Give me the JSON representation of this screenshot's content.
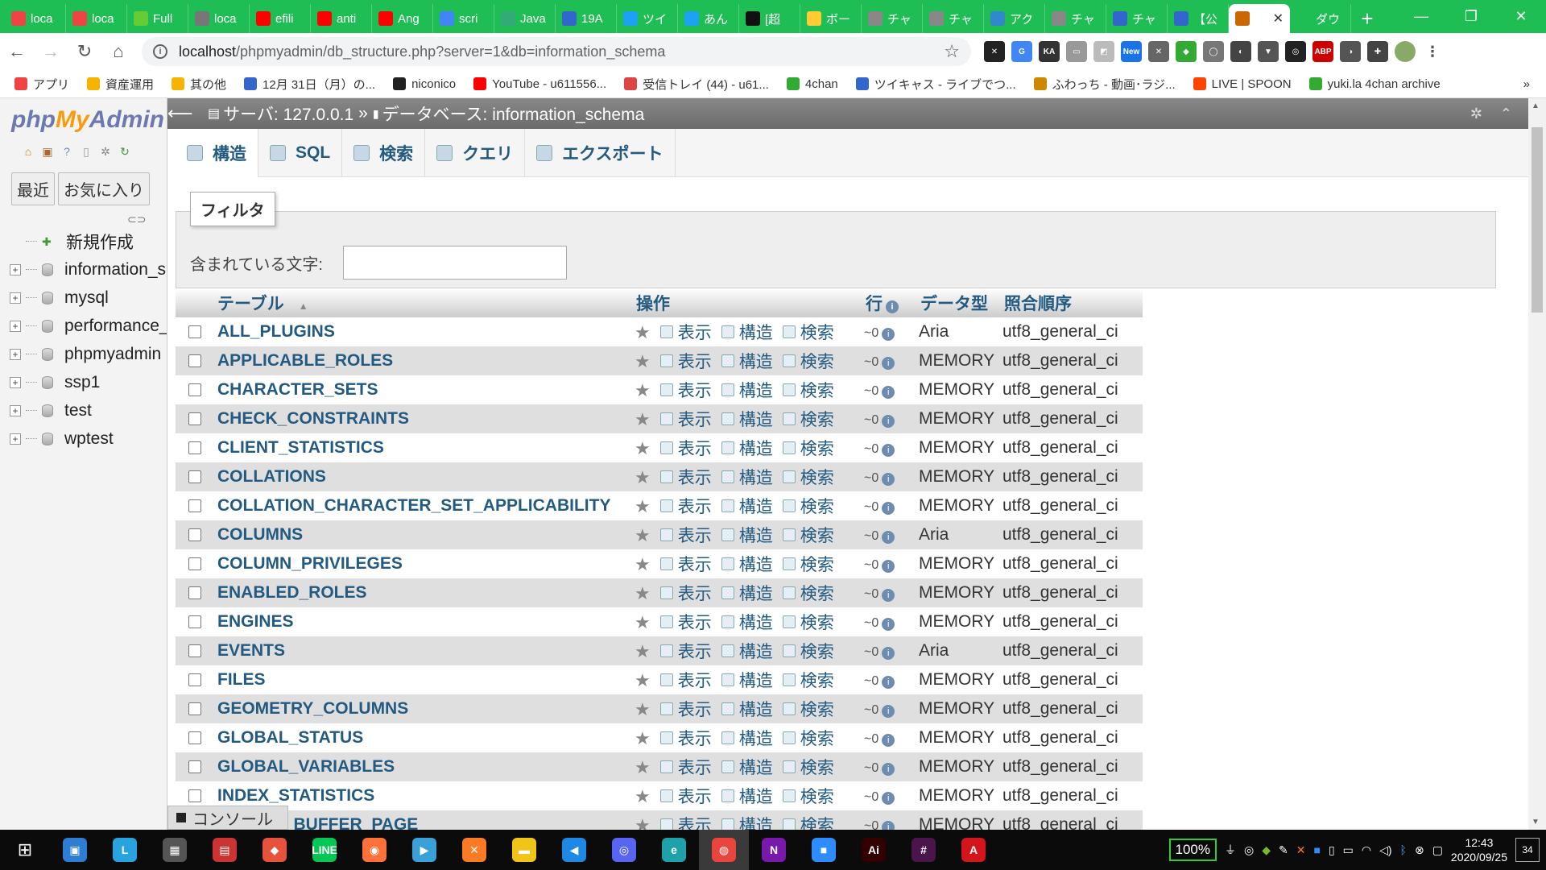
{
  "browser": {
    "tabs": [
      {
        "label": "loca",
        "color": "#e44"
      },
      {
        "label": "loca",
        "color": "#e44"
      },
      {
        "label": "Full",
        "color": "#6c3"
      },
      {
        "label": "loca",
        "color": "#777"
      },
      {
        "label": "efili",
        "color": "#f00"
      },
      {
        "label": "anti",
        "color": "#f00"
      },
      {
        "label": "Ang",
        "color": "#f00"
      },
      {
        "label": "scri",
        "color": "#4285f4"
      },
      {
        "label": "Java",
        "color": "#3a7"
      },
      {
        "label": "19A",
        "color": "#36c"
      },
      {
        "label": "ツイ",
        "color": "#1da1f2"
      },
      {
        "label": "あん",
        "color": "#1da1f2"
      },
      {
        "label": "[超",
        "color": "#111"
      },
      {
        "label": "ボー",
        "color": "#fc3"
      },
      {
        "label": "チャ",
        "color": "#888"
      },
      {
        "label": "チャ",
        "color": "#888"
      },
      {
        "label": "アク",
        "color": "#38c"
      },
      {
        "label": "チャ",
        "color": "#888"
      },
      {
        "label": "チャ",
        "color": "#36c"
      },
      {
        "label": "【公",
        "color": "#36c"
      },
      {
        "label": "",
        "color": "#c60",
        "active": true
      },
      {
        "label": "ダウ",
        "color": "#1fbe55"
      }
    ],
    "url_host": "localhost",
    "url_path": "/phpmyadmin/db_structure.php?server=1&db=information_schema",
    "bookmarks": [
      "アプリ",
      "資産運用",
      "其の他",
      "12月 31日（月）の...",
      "niconico",
      "YouTube - u611556...",
      "受信トレイ (44) - u61...",
      "4chan",
      "ツイキャス - ライブでつ...",
      "ふわっち - 動画･ラジ...",
      "LIVE | SPOON",
      "yuki.la 4chan archive"
    ],
    "bookmarks_more": "»",
    "new_ext_label": "New"
  },
  "nav": {
    "logo_php": "php",
    "logo_my": "My",
    "logo_admin": "Admin",
    "tab_recent": "最近",
    "tab_favorites": "お気に入り",
    "tree": [
      {
        "label": "新規作成",
        "type": "new"
      },
      {
        "label": "information_s",
        "type": "db"
      },
      {
        "label": "mysql",
        "type": "db"
      },
      {
        "label": "performance_",
        "type": "db"
      },
      {
        "label": "phpmyadmin",
        "type": "db"
      },
      {
        "label": "ssp1",
        "type": "db"
      },
      {
        "label": "test",
        "type": "db"
      },
      {
        "label": "wptest",
        "type": "db"
      }
    ]
  },
  "breadcrumb": {
    "server_label": "サーバ: 127.0.0.1",
    "separator": "»",
    "db_label": "データベース: information_schema"
  },
  "menu": [
    "構造",
    "SQL",
    "検索",
    "クエリ",
    "エクスポート"
  ],
  "filter": {
    "legend": "フィルタ",
    "label": "含まれている文字:",
    "value": ""
  },
  "table": {
    "headers": {
      "table": "テーブル",
      "action": "操作",
      "rows": "行",
      "type": "データ型",
      "collation": "照合順序"
    },
    "action_labels": {
      "browse": "表示",
      "structure": "構造",
      "search": "検索"
    },
    "rows": [
      {
        "name": "ALL_PLUGINS",
        "rows": "~0",
        "type": "Aria",
        "collation": "utf8_general_ci"
      },
      {
        "name": "APPLICABLE_ROLES",
        "rows": "~0",
        "type": "MEMORY",
        "collation": "utf8_general_ci"
      },
      {
        "name": "CHARACTER_SETS",
        "rows": "~0",
        "type": "MEMORY",
        "collation": "utf8_general_ci"
      },
      {
        "name": "CHECK_CONSTRAINTS",
        "rows": "~0",
        "type": "MEMORY",
        "collation": "utf8_general_ci"
      },
      {
        "name": "CLIENT_STATISTICS",
        "rows": "~0",
        "type": "MEMORY",
        "collation": "utf8_general_ci"
      },
      {
        "name": "COLLATIONS",
        "rows": "~0",
        "type": "MEMORY",
        "collation": "utf8_general_ci"
      },
      {
        "name": "COLLATION_CHARACTER_SET_APPLICABILITY",
        "rows": "~0",
        "type": "MEMORY",
        "collation": "utf8_general_ci"
      },
      {
        "name": "COLUMNS",
        "rows": "~0",
        "type": "Aria",
        "collation": "utf8_general_ci"
      },
      {
        "name": "COLUMN_PRIVILEGES",
        "rows": "~0",
        "type": "MEMORY",
        "collation": "utf8_general_ci"
      },
      {
        "name": "ENABLED_ROLES",
        "rows": "~0",
        "type": "MEMORY",
        "collation": "utf8_general_ci"
      },
      {
        "name": "ENGINES",
        "rows": "~0",
        "type": "MEMORY",
        "collation": "utf8_general_ci"
      },
      {
        "name": "EVENTS",
        "rows": "~0",
        "type": "Aria",
        "collation": "utf8_general_ci"
      },
      {
        "name": "FILES",
        "rows": "~0",
        "type": "MEMORY",
        "collation": "utf8_general_ci"
      },
      {
        "name": "GEOMETRY_COLUMNS",
        "rows": "~0",
        "type": "MEMORY",
        "collation": "utf8_general_ci"
      },
      {
        "name": "GLOBAL_STATUS",
        "rows": "~0",
        "type": "MEMORY",
        "collation": "utf8_general_ci"
      },
      {
        "name": "GLOBAL_VARIABLES",
        "rows": "~0",
        "type": "MEMORY",
        "collation": "utf8_general_ci"
      },
      {
        "name": "INDEX_STATISTICS",
        "rows": "~0",
        "type": "MEMORY",
        "collation": "utf8_general_ci"
      },
      {
        "name": "INNODB_BUFFER_PAGE",
        "rows": "~0",
        "type": "MEMORY",
        "collation": "utf8_general_ci"
      }
    ]
  },
  "console_label": "コンソール",
  "taskbar": {
    "apps": [
      {
        "name": "explorer-window",
        "color": "#2d7dd2",
        "glyph": "▣"
      },
      {
        "name": "l-app",
        "color": "#29a3e0",
        "glyph": "L"
      },
      {
        "name": "calculator",
        "color": "#555",
        "glyph": "▦"
      },
      {
        "name": "train-app",
        "color": "#c33",
        "glyph": "▤"
      },
      {
        "name": "flame-app",
        "color": "#e5533c",
        "glyph": "◆"
      },
      {
        "name": "line-app",
        "color": "#06c755",
        "glyph": "LINE"
      },
      {
        "name": "firefox",
        "color": "#ff7139",
        "glyph": "◉"
      },
      {
        "name": "player-app",
        "color": "#3aa0d8",
        "glyph": "▶"
      },
      {
        "name": "xampp",
        "color": "#fb7a24",
        "glyph": "✕"
      },
      {
        "name": "file-explorer",
        "color": "#f0c419",
        "glyph": "▬"
      },
      {
        "name": "vscode",
        "color": "#1e88e5",
        "glyph": "◀"
      },
      {
        "name": "discord",
        "color": "#5865f2",
        "glyph": "◎"
      },
      {
        "name": "edge",
        "color": "#1fa1a9",
        "glyph": "e"
      },
      {
        "name": "chrome",
        "color": "#e8453c",
        "glyph": "◍",
        "active": true
      },
      {
        "name": "onenote",
        "color": "#7719aa",
        "glyph": "N"
      },
      {
        "name": "zoom",
        "color": "#2d8cff",
        "glyph": "■"
      },
      {
        "name": "illustrator",
        "color": "#330000",
        "glyph": "Ai"
      },
      {
        "name": "slack",
        "color": "#4a154b",
        "glyph": "#"
      },
      {
        "name": "acrobat",
        "color": "#d4161c",
        "glyph": "A"
      }
    ],
    "zoom": "100%",
    "time": "12:43",
    "date": "2020/09/25",
    "notif_count": "34"
  }
}
